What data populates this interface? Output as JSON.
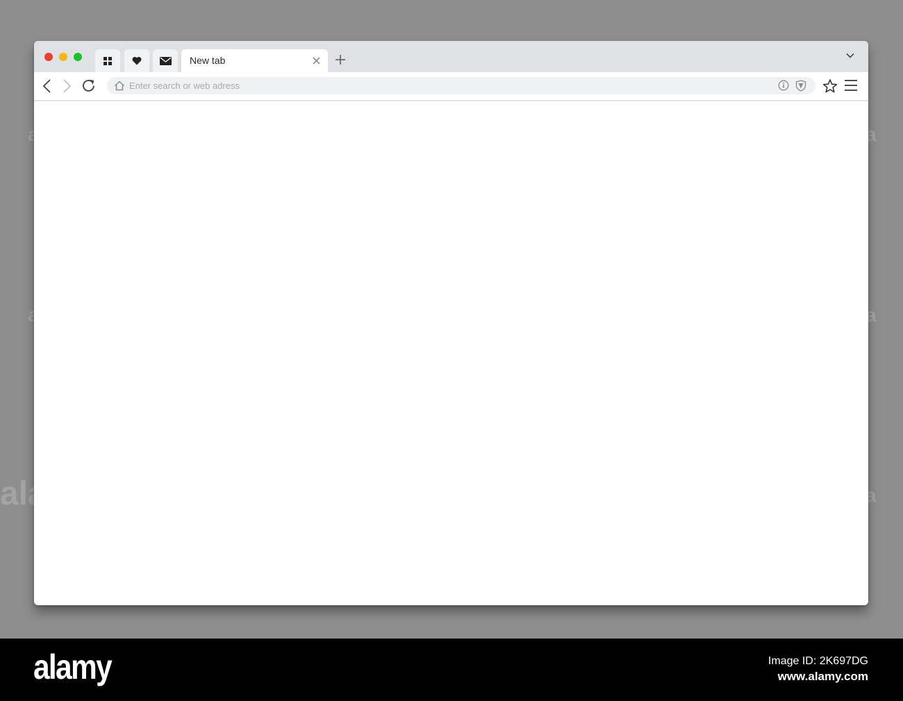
{
  "colors": {
    "background": "#8e8e8e",
    "tab_bar": "#dfe1e5",
    "address_bar": "#f0f1f2",
    "close_dot": "#ee3b33",
    "minimize_dot": "#f5b514",
    "maximize_dot": "#19c231"
  },
  "window_controls": {
    "close_icon": "red-close-dot",
    "minimize_icon": "yellow-minimize-dot",
    "maximize_icon": "green-maximize-dot"
  },
  "tabs": {
    "pinned": [
      {
        "icon": "grid-icon"
      },
      {
        "icon": "heart-icon"
      },
      {
        "icon": "envelope-icon"
      }
    ],
    "active": {
      "title": "New tab",
      "close_icon": "close-icon"
    },
    "new_tab_icon": "plus-icon",
    "tab_list_icon": "chevron-down-icon"
  },
  "toolbar": {
    "back_icon": "back-arrow-icon",
    "forward_icon": "forward-arrow-icon",
    "reload_icon": "reload-icon",
    "address": {
      "home_icon": "home-icon",
      "placeholder": "Enter search or web adress",
      "value": "",
      "info_icon": "info-icon",
      "shield_icon": "shield-icon"
    },
    "bookmark_icon": "star-icon",
    "menu_icon": "hamburger-menu-icon"
  },
  "watermark": {
    "site_logo": "alamy",
    "image_id": "Image ID: 2K697DG",
    "url": "www.alamy.com"
  }
}
